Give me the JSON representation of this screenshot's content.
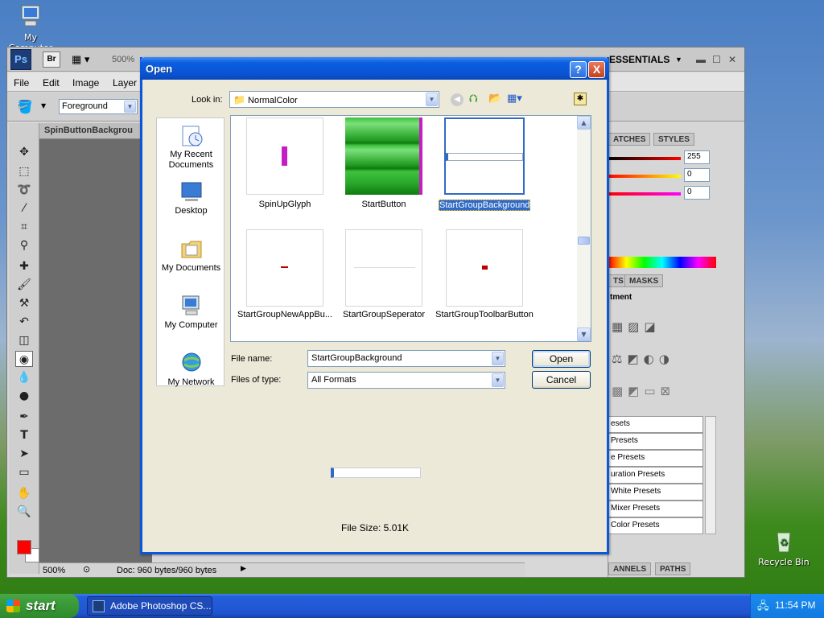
{
  "desktop": {
    "icons": [
      {
        "label": "My Computer"
      },
      {
        "label": "Recycle Bin"
      }
    ]
  },
  "photoshop": {
    "logo": "Ps",
    "bridge": "Br",
    "zoom": "500%",
    "workspace": "ESSENTIALS",
    "menu": [
      "File",
      "Edit",
      "Image",
      "Layer"
    ],
    "options_preset": "Foreground",
    "doc_tab": "SpinButtonBackgrou",
    "status_zoom": "500%",
    "status_doc": "Doc: 960 bytes/960 bytes",
    "panels": {
      "color_tabs": [
        "ATCHES",
        "STYLES"
      ],
      "color_values": [
        "255",
        "0",
        "0"
      ],
      "adjust_tabs": [
        "TS",
        "MASKS"
      ],
      "adjust_title": "tment",
      "presets": [
        "esets",
        "Presets",
        "e Presets",
        "uration Presets",
        "White Presets",
        "Mixer Presets",
        " Color Presets"
      ],
      "bottom_tabs": [
        "ANNELS",
        "PATHS"
      ]
    }
  },
  "dialog": {
    "title": "Open",
    "look_in_label": "Look in:",
    "look_in_value": "NormalColor",
    "places": [
      "My Recent\nDocuments",
      "Desktop",
      "My Documents",
      "My Computer",
      "My Network"
    ],
    "files": [
      {
        "name": "SpinUpGlyph"
      },
      {
        "name": "StartButton"
      },
      {
        "name": "StartGroupBackground"
      },
      {
        "name": "StartGroupNewAppBu..."
      },
      {
        "name": "StartGroupSeperator"
      },
      {
        "name": "StartGroupToolbarButton"
      }
    ],
    "file_name_label": "File name:",
    "file_name_value": "StartGroupBackground",
    "file_type_label": "Files of type:",
    "file_type_value": "All Formats",
    "open_label": "Open",
    "cancel_label": "Cancel",
    "file_size": "File Size: 5.01K",
    "help": "?",
    "close": "X"
  },
  "taskbar": {
    "start": "start",
    "task": "Adobe Photoshop CS...",
    "clock": "11:54 PM"
  }
}
